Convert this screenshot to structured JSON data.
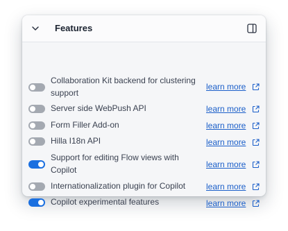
{
  "panel": {
    "title": "Features",
    "icons": {
      "collapse": "chevron-down-icon",
      "dock": "panel-dock-icon"
    }
  },
  "colors": {
    "toggle_on": "#1a6fe0",
    "toggle_off": "#a4a9b1",
    "link": "#1a5ec9"
  },
  "features": [
    {
      "label": "Collaboration Kit backend for clustering support",
      "enabled": false,
      "link": "learn more"
    },
    {
      "label": "Server side WebPush API",
      "enabled": false,
      "link": "learn more"
    },
    {
      "label": "Form Filler Add-on",
      "enabled": false,
      "link": "learn more"
    },
    {
      "label": "Hilla I18n API",
      "enabled": false,
      "link": "learn more"
    },
    {
      "label": "Support for editing Flow views with Copilot",
      "enabled": true,
      "link": "learn more"
    },
    {
      "label": "Internationalization plugin for Copilot",
      "enabled": false,
      "link": "learn more"
    },
    {
      "label": "Copilot experimental features",
      "enabled": true,
      "link": "learn more"
    }
  ]
}
